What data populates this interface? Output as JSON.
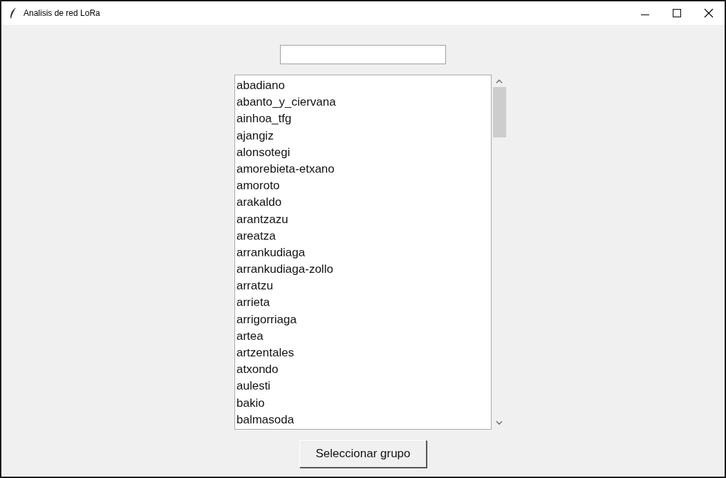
{
  "window": {
    "title": "Analisis de red LoRa"
  },
  "list": {
    "items": [
      {
        "label": "abadiano",
        "selected": false
      },
      {
        "label": "abanto_y_ciervana",
        "selected": false
      },
      {
        "label": "ainhoa_tfg",
        "selected": false
      },
      {
        "label": "ajangiz",
        "selected": false
      },
      {
        "label": "alonsotegi",
        "selected": false
      },
      {
        "label": "amorebieta-etxano",
        "selected": false
      },
      {
        "label": "amoroto",
        "selected": false
      },
      {
        "label": "arakaldo",
        "selected": false
      },
      {
        "label": "arantzazu",
        "selected": false
      },
      {
        "label": "areatza",
        "selected": false
      },
      {
        "label": "arrankudiaga",
        "selected": false
      },
      {
        "label": "arrankudiaga-zollo",
        "selected": false
      },
      {
        "label": "arratzu",
        "selected": false
      },
      {
        "label": "arrieta",
        "selected": false
      },
      {
        "label": "arrigorriaga",
        "selected": false
      },
      {
        "label": "artea",
        "selected": false
      },
      {
        "label": "artzentales",
        "selected": false
      },
      {
        "label": "atxondo",
        "selected": false
      },
      {
        "label": "aulesti",
        "selected": false
      },
      {
        "label": "bakio",
        "selected": false
      },
      {
        "label": "balmasoda",
        "selected": false
      }
    ]
  },
  "button": {
    "label": "Seleccionar grupo"
  }
}
